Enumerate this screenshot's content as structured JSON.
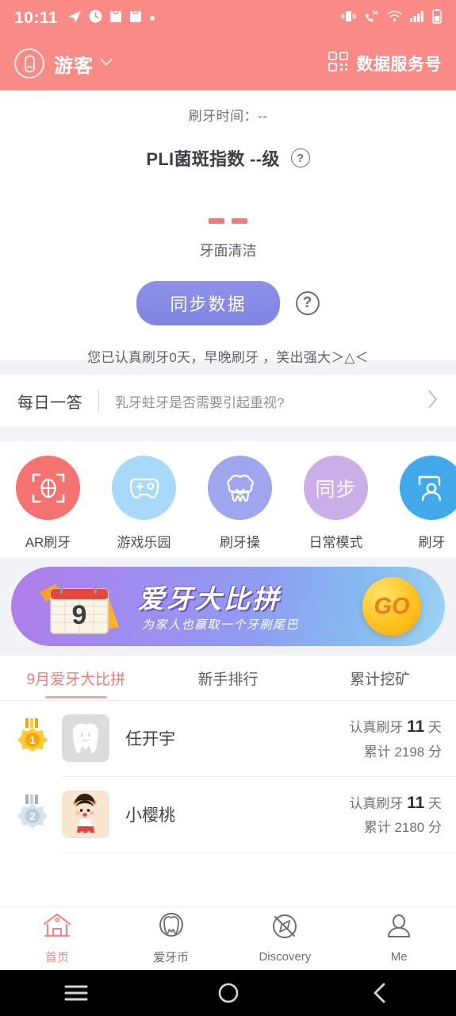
{
  "statusbar": {
    "time": "10:11",
    "left_icons": [
      "telegram-icon",
      "clock-icon",
      "bag-icon",
      "bag-icon",
      "dot-icon"
    ],
    "right_icons": [
      "vibrate-icon",
      "missed-call-icon",
      "wifi-icon",
      "signal-icon",
      "battery-icon"
    ]
  },
  "appbar": {
    "user_name": "游客",
    "service_label": "数据服务号",
    "background_color": "#f98a86"
  },
  "hero": {
    "brush_time_label": "刷牙时间：--",
    "pli_title": "PLI菌斑指数  --级",
    "help_mark": "?",
    "clean_label": "牙面清洁",
    "sync_button_label": "同步数据",
    "sync_button_color": "#8589e4",
    "encourage_text": "您已认真刷牙0天，早晚刷牙 ，笑出强大＞△＜",
    "dash_color": "#f47a77"
  },
  "daily": {
    "title": "每日一答",
    "question": "乳牙蛀牙是否需要引起重视?",
    "chevron": "›"
  },
  "shortcuts": [
    {
      "label": "AR刷牙",
      "icon": "ar-brush-icon",
      "color": "#f4726f"
    },
    {
      "label": "游戏乐园",
      "icon": "gamepad-icon",
      "color": "#a9d9f8"
    },
    {
      "label": "刷牙操",
      "icon": "tooth-face-icon",
      "color": "#a0a6ee"
    },
    {
      "label": "日常模式",
      "icon": "sync-text-icon",
      "color": "#c9aee8"
    },
    {
      "label": "刷牙",
      "icon": "user-card-icon",
      "color": "#42aaeb"
    }
  ],
  "banner": {
    "calendar_number": "9",
    "title": "爱牙大比拼",
    "subtitle": "为家人也赢取一个牙刷尾巴",
    "go_label": "GO"
  },
  "tabs": [
    {
      "label": "9月爱牙大比拼",
      "active": true
    },
    {
      "label": "新手排行",
      "active": false
    },
    {
      "label": "累计挖矿",
      "active": false
    }
  ],
  "tab_active_color": "#ec7c7c",
  "ranking": [
    {
      "rank": "1",
      "medal": "gold-medal-icon",
      "avatar": "tooth-avatar",
      "name": "任开宇",
      "days_prefix": "认真刷牙",
      "days_value": "11",
      "days_suffix": "天",
      "points_prefix": "累计",
      "points_value": "2198",
      "points_suffix": "分"
    },
    {
      "rank": "2",
      "medal": "silver-medal-icon",
      "avatar": "maruko-avatar",
      "name": "小樱桃",
      "days_prefix": "认真刷牙",
      "days_value": "11",
      "days_suffix": "天",
      "points_prefix": "累计",
      "points_value": "2180",
      "points_suffix": "分"
    }
  ],
  "bottom_nav": [
    {
      "label": "首页",
      "icon": "home-icon",
      "active": true
    },
    {
      "label": "爱牙币",
      "icon": "tooth-coin-icon",
      "active": false
    },
    {
      "label": "Discovery",
      "icon": "compass-icon",
      "active": false
    },
    {
      "label": "Me",
      "icon": "person-icon",
      "active": false
    }
  ],
  "system_nav": [
    {
      "icon": "menu-icon"
    },
    {
      "icon": "home-circle-icon"
    },
    {
      "icon": "back-icon"
    }
  ]
}
